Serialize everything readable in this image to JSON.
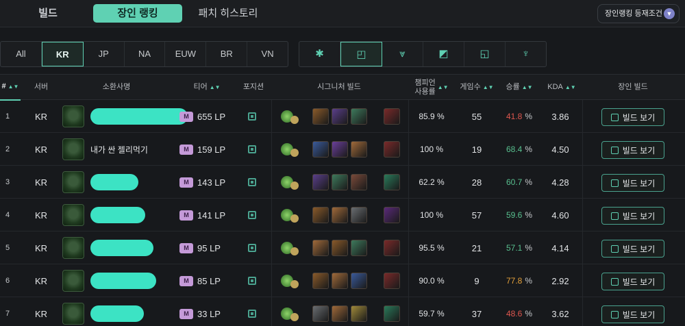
{
  "top_tabs": [
    "빌드",
    "장인 랭킹",
    "패치 히스토리"
  ],
  "criteria_button": "장인랭킹 등재조건",
  "regions": [
    "All",
    "KR",
    "JP",
    "NA",
    "EUW",
    "BR",
    "VN"
  ],
  "active_region": "KR",
  "positions": [
    "all-position-icon",
    "jungle-icon",
    "top-icon",
    "mid-icon",
    "bottom-icon",
    "support-icon"
  ],
  "columns": {
    "rank": "#",
    "server": "서버",
    "summoner": "소환사명",
    "tier": "티어",
    "position": "포지션",
    "signature_build": "시그니처 빌드",
    "champion_usage": "챔피언\n사용률",
    "games": "게임수",
    "winrate": "승률",
    "kda": "KDA",
    "master_build": "장인 빌드"
  },
  "colors": {
    "accent": "#5fd1b3",
    "win_red": "#e0574f",
    "win_green": "#58c08f",
    "win_orange": "#e5a13a"
  },
  "rows": [
    {
      "rank": "1",
      "server": "KR",
      "name": "",
      "tier_badge": "M",
      "lp": "655 LP",
      "pick_rate": "85.9 %",
      "games": "55",
      "win_rate": "41.8",
      "win_pct": "%",
      "kda": "3.86",
      "build_label": "빌드 보기"
    },
    {
      "rank": "2",
      "server": "KR",
      "name": "내가 싼 젤리먹기",
      "tier_badge": "M",
      "lp": "159 LP",
      "pick_rate": "100 %",
      "games": "19",
      "win_rate": "68.4",
      "win_pct": "%",
      "kda": "4.50",
      "build_label": "빌드 보기"
    },
    {
      "rank": "3",
      "server": "KR",
      "name": "",
      "tier_badge": "M",
      "lp": "143 LP",
      "pick_rate": "62.2 %",
      "games": "28",
      "win_rate": "60.7",
      "win_pct": "%",
      "kda": "4.28",
      "build_label": "빌드 보기"
    },
    {
      "rank": "4",
      "server": "KR",
      "name": "",
      "tier_badge": "M",
      "lp": "141 LP",
      "pick_rate": "100 %",
      "games": "57",
      "win_rate": "59.6",
      "win_pct": "%",
      "kda": "4.60",
      "build_label": "빌드 보기"
    },
    {
      "rank": "5",
      "server": "KR",
      "name": "",
      "tier_badge": "M",
      "lp": "95 LP",
      "pick_rate": "95.5 %",
      "games": "21",
      "win_rate": "57.1",
      "win_pct": "%",
      "kda": "4.14",
      "build_label": "빌드 보기"
    },
    {
      "rank": "6",
      "server": "KR",
      "name": "",
      "tier_badge": "M",
      "lp": "85 LP",
      "pick_rate": "90.0 %",
      "games": "9",
      "win_rate": "77.8",
      "win_pct": "%",
      "kda": "2.92",
      "build_label": "빌드 보기"
    },
    {
      "rank": "7",
      "server": "KR",
      "name": "",
      "tier_badge": "M",
      "lp": "33 LP",
      "pick_rate": "59.7 %",
      "games": "37",
      "win_rate": "48.6",
      "win_pct": "%",
      "kda": "3.62",
      "build_label": "빌드 보기"
    }
  ]
}
